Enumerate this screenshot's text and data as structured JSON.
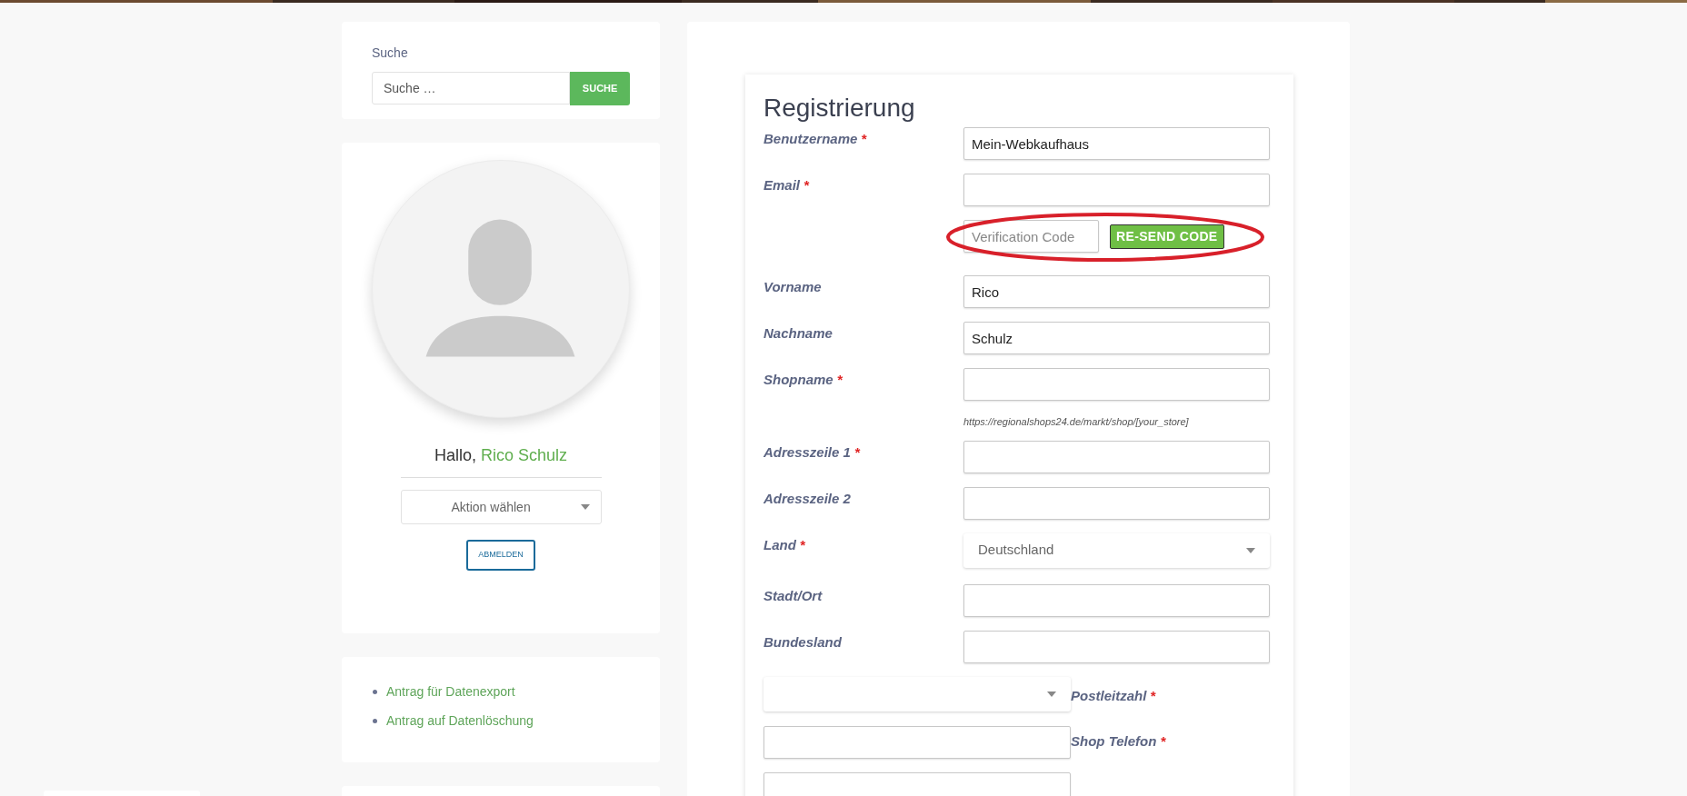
{
  "search": {
    "label": "Suche",
    "placeholder": "Suche …",
    "button": "SUCHE"
  },
  "profile": {
    "greeting": "Hallo,",
    "name": "Rico Schulz",
    "action_select": "Aktion wählen",
    "logout": "ABMELDEN"
  },
  "links": [
    "Antrag für Datenexport",
    "Antrag auf Datenlöschung"
  ],
  "form": {
    "title": "Registrierung",
    "fields": [
      {
        "kind": "text",
        "label": "Benutzername",
        "required_mark": "*",
        "value": "Mein-Webkaufhaus"
      },
      {
        "kind": "text",
        "label": "Email",
        "required_mark": "*"
      },
      {
        "kind": "verification",
        "placeholder": "Verification Code",
        "button": "RE-SEND CODE"
      },
      {
        "kind": "text",
        "label": "Vorname",
        "value": "Rico"
      },
      {
        "kind": "text",
        "label": "Nachname",
        "value": "Schulz"
      },
      {
        "kind": "text",
        "label": "Shopname",
        "required_mark": "*"
      },
      {
        "kind": "hint",
        "text": "https://regionalshops24.de/markt/shop/[your_store]"
      },
      {
        "kind": "text",
        "label": "Adresszeile 1",
        "required_mark": "*"
      },
      {
        "kind": "text",
        "label": "Adresszeile 2"
      },
      {
        "kind": "select",
        "label": "Land",
        "required_mark": "*",
        "value": "Deutschland"
      },
      {
        "kind": "text",
        "label": "Stadt/Ort"
      },
      {
        "kind": "text",
        "label": "Bundesland"
      },
      {
        "kind": "inline_select",
        "label": "Postleitzahl",
        "required_mark": "*"
      },
      {
        "kind": "inline_text",
        "label": "Shop Telefon",
        "required_mark": "*"
      },
      {
        "kind": "inline_text"
      }
    ]
  }
}
